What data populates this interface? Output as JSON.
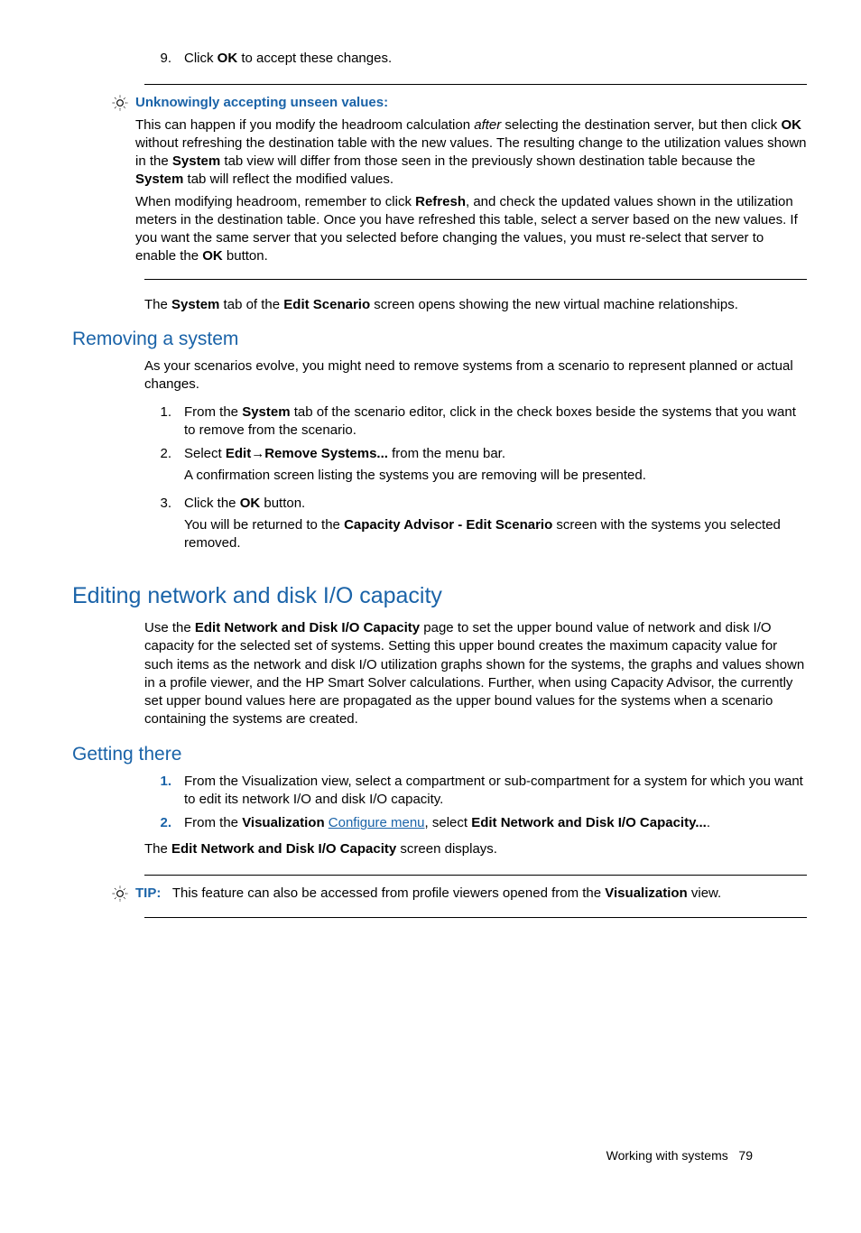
{
  "step9": {
    "num": "9.",
    "pre": "Click ",
    "ok": "OK",
    "post": " to accept these changes."
  },
  "callout1": {
    "title": "Unknowingly accepting unseen values:",
    "p1a": "This can happen if you modify the headroom calculation ",
    "p1b_i": "after",
    "p1c": " selecting the destination server, but then click ",
    "p1d_b": "OK",
    "p1e": " without refreshing the destination table with the new values. The resulting change to the utilization values shown in the ",
    "p1f_b": "System",
    "p1g": " tab view will differ from those seen in the previously shown destination table because the ",
    "p1h_b": "System",
    "p1i": " tab will reflect the modified values.",
    "p2a": "When modifying headroom, remember to click ",
    "p2b_b": "Refresh",
    "p2c": ", and check the updated values shown in the utilization meters in the destination table. Once you have refreshed this table, select a server based on the new values. If you want the same server that you selected before changing the values, you must re-select that server to enable the ",
    "p2d_b": "OK",
    "p2e": " button."
  },
  "after_callout": {
    "a": "The ",
    "b_b": "System",
    "c": " tab of the ",
    "d_b": "Edit Scenario",
    "e": " screen opens showing the new virtual machine relationships."
  },
  "removing": {
    "title": "Removing a system",
    "intro": "As your scenarios evolve, you might need to remove systems from a scenario to represent planned or actual changes.",
    "s1": {
      "num": "1.",
      "a": "From the ",
      "b_b": "System",
      "c": " tab of the scenario editor, click in the check boxes beside the systems that you want to remove from the scenario."
    },
    "s2": {
      "num": "2.",
      "a": "Select ",
      "b_b": "Edit",
      "c_b": "Remove Systems...",
      "d": " from the menu bar.",
      "p2": "A confirmation screen listing the systems you are removing will be presented."
    },
    "s3": {
      "num": "3.",
      "a": "Click the ",
      "b_b": "OK",
      "c": " button.",
      "p2a": "You will be returned to the ",
      "p2b_b": "Capacity Advisor - Edit Scenario",
      "p2c": " screen with the systems you selected removed."
    }
  },
  "editing": {
    "title": "Editing network and disk I/O capacity",
    "intro_a": "Use the ",
    "intro_b_b": "Edit Network and Disk I/O Capacity",
    "intro_c": " page to set the upper bound value of network and disk I/O capacity for the selected set of systems. Setting this upper bound creates the maximum capacity value for such items as the network and disk I/O utilization graphs shown for the systems, the graphs and values shown in a profile viewer, and the HP Smart Solver calculations. Further, when using Capacity Advisor, the currently set upper bound values here are propagated as the upper bound values for the systems when a scenario containing the systems are created.",
    "getting_title": "Getting there",
    "s1": {
      "num": "1.",
      "text": "From the Visualization view, select a compartment or sub-compartment for a system for which you want to edit its network I/O and disk I/O capacity."
    },
    "s2": {
      "num": "2.",
      "a": "From the ",
      "b_b": "Visualization",
      "c_link": "Configure menu",
      "d": ", select ",
      "e_b": "Edit Network and Disk I/O Capacity...",
      "f": "."
    },
    "after_a": "The ",
    "after_b_b": "Edit Network and Disk I/O Capacity",
    "after_c": " screen displays."
  },
  "tip": {
    "label": "TIP:",
    "a": "This feature can also be accessed from profile viewers opened from the ",
    "b_b": "Visualization",
    "c": " view."
  },
  "footer": {
    "text": "Working with systems",
    "page": "79"
  }
}
